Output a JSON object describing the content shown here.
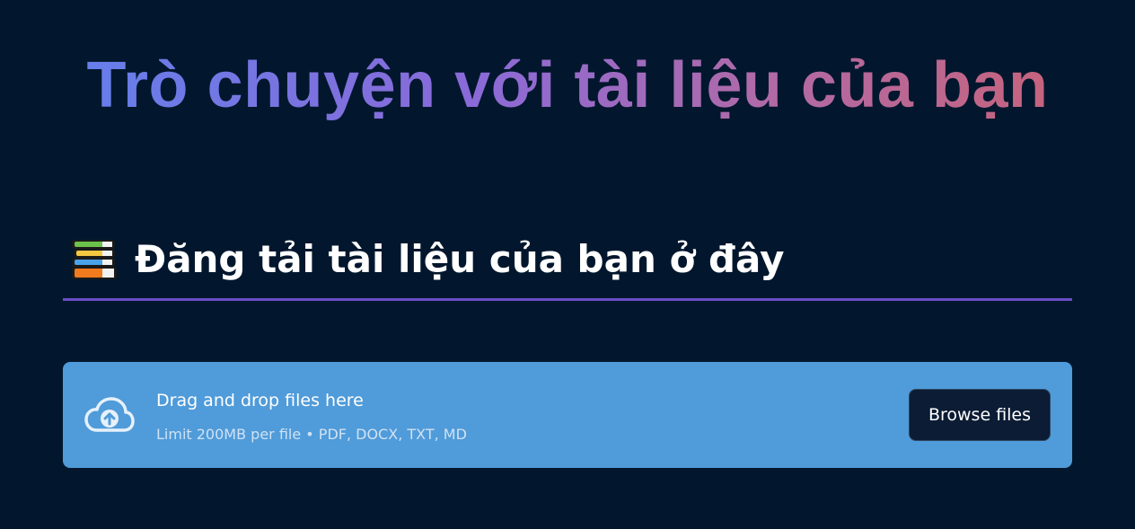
{
  "hero": {
    "title": "Trò chuyện với tài liệu của bạn",
    "gradient_colors": [
      "#667eea",
      "#8a6ad8",
      "#b06aa8",
      "#c5647e"
    ]
  },
  "upload_section": {
    "icon": "books-icon",
    "title": "Đăng tải tài liệu của bạn ở đây",
    "divider_color": "#6a4cc6"
  },
  "file_uploader": {
    "icon": "cloud-upload-icon",
    "instruction": "Drag and drop files here",
    "limit_text": "Limit 200MB per file • PDF, DOCX, TXT, MD",
    "browse_label": "Browse files",
    "background_color": "#509bd9"
  },
  "theme": {
    "background": "#02172d",
    "button_background": "#0b1c34"
  }
}
